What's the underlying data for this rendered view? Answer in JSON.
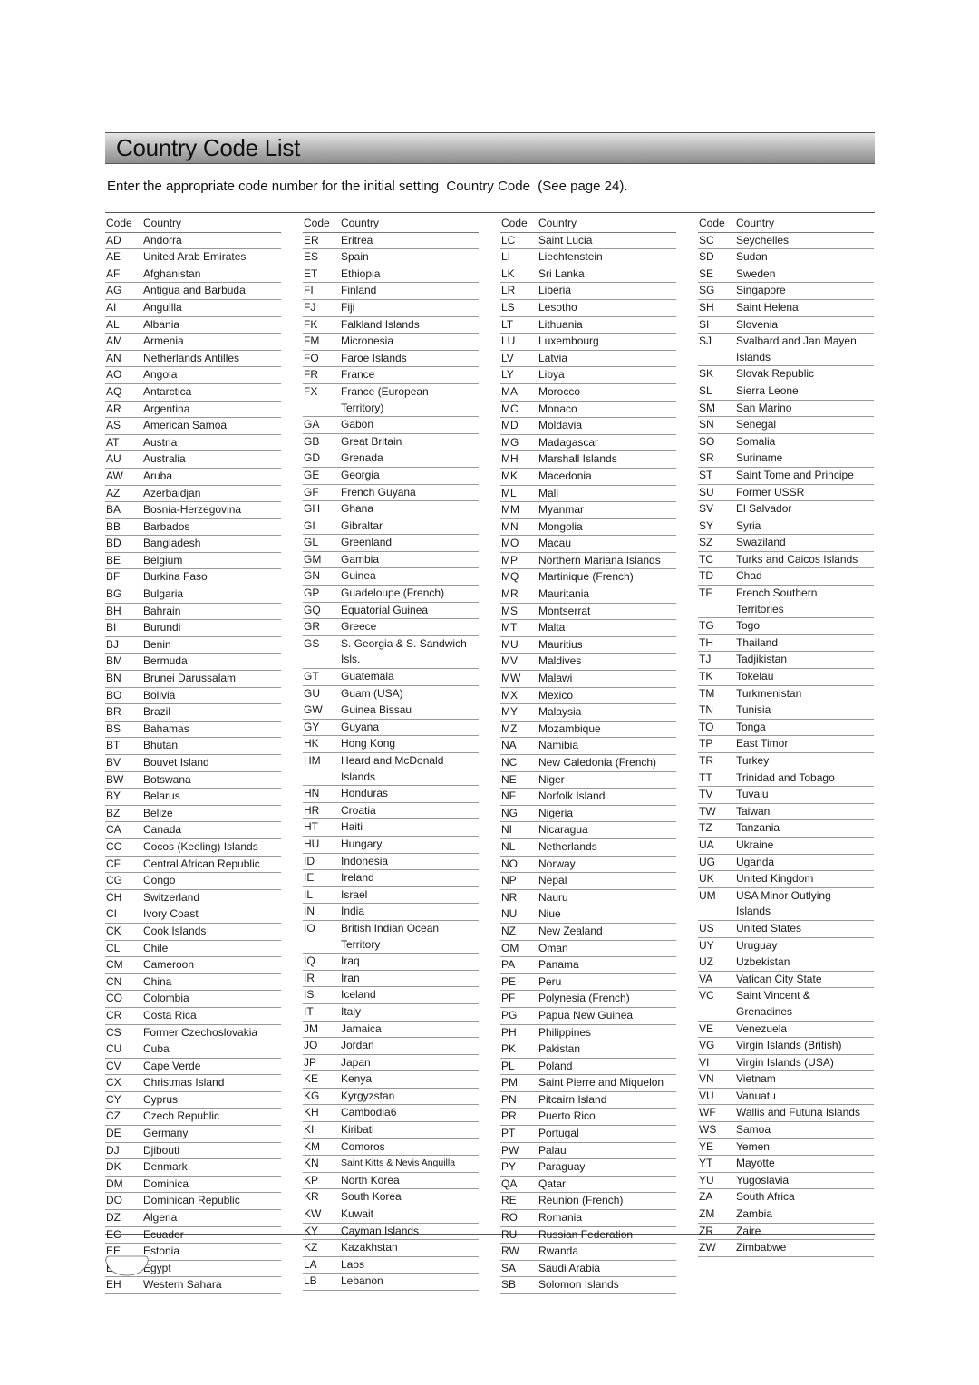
{
  "title": "Country Code List",
  "intro": "Enter the appropriate code number for the initial setting  Country Code  (See page 24).",
  "table": {
    "header": {
      "code": "Code",
      "country": "Country"
    },
    "columns": [
      [
        [
          "AD",
          "Andorra"
        ],
        [
          "AE",
          "United Arab Emirates"
        ],
        [
          "AF",
          "Afghanistan"
        ],
        [
          "AG",
          "Antigua and Barbuda"
        ],
        [
          "AI",
          "Anguilla"
        ],
        [
          "AL",
          "Albania"
        ],
        [
          "AM",
          "Armenia"
        ],
        [
          "AN",
          "Netherlands Antilles"
        ],
        [
          "AO",
          "Angola"
        ],
        [
          "AQ",
          "Antarctica"
        ],
        [
          "AR",
          "Argentina"
        ],
        [
          "AS",
          "American Samoa"
        ],
        [
          "AT",
          "Austria"
        ],
        [
          "AU",
          "Australia"
        ],
        [
          "AW",
          "Aruba"
        ],
        [
          "AZ",
          "Azerbaidjan"
        ],
        [
          "BA",
          "Bosnia-Herzegovina"
        ],
        [
          "BB",
          "Barbados"
        ],
        [
          "BD",
          "Bangladesh"
        ],
        [
          "BE",
          "Belgium"
        ],
        [
          "BF",
          "Burkina Faso"
        ],
        [
          "BG",
          "Bulgaria"
        ],
        [
          "BH",
          "Bahrain"
        ],
        [
          "BI",
          "Burundi"
        ],
        [
          "BJ",
          "Benin"
        ],
        [
          "BM",
          "Bermuda"
        ],
        [
          "BN",
          "Brunei Darussalam"
        ],
        [
          "BO",
          "Bolivia"
        ],
        [
          "BR",
          "Brazil"
        ],
        [
          "BS",
          "Bahamas"
        ],
        [
          "BT",
          "Bhutan"
        ],
        [
          "BV",
          "Bouvet Island"
        ],
        [
          "BW",
          "Botswana"
        ],
        [
          "BY",
          "Belarus"
        ],
        [
          "BZ",
          "Belize"
        ],
        [
          "CA",
          "Canada"
        ],
        [
          "CC",
          "Cocos (Keeling) Islands"
        ],
        [
          "CF",
          "Central African Republic"
        ],
        [
          "CG",
          "Congo"
        ],
        [
          "CH",
          "Switzerland"
        ],
        [
          "CI",
          "Ivory Coast"
        ],
        [
          "CK",
          "Cook Islands"
        ],
        [
          "CL",
          "Chile"
        ],
        [
          "CM",
          "Cameroon"
        ],
        [
          "CN",
          "China"
        ],
        [
          "CO",
          "Colombia"
        ],
        [
          "CR",
          "Costa Rica"
        ],
        [
          "CS",
          "Former Czechoslovakia"
        ],
        [
          "CU",
          "Cuba"
        ],
        [
          "CV",
          "Cape Verde"
        ],
        [
          "CX",
          "Christmas Island"
        ],
        [
          "CY",
          "Cyprus"
        ],
        [
          "CZ",
          "Czech Republic"
        ],
        [
          "DE",
          "Germany"
        ],
        [
          "DJ",
          "Djibouti"
        ],
        [
          "DK",
          "Denmark"
        ],
        [
          "DM",
          "Dominica"
        ],
        [
          "DO",
          "Dominican Republic"
        ],
        [
          "DZ",
          "Algeria"
        ],
        [
          "EC",
          "Ecuador"
        ],
        [
          "EE",
          "Estonia"
        ],
        [
          "EG",
          "Egypt"
        ],
        [
          "EH",
          "Western Sahara"
        ]
      ],
      [
        [
          "ER",
          "Eritrea"
        ],
        [
          "ES",
          "Spain"
        ],
        [
          "ET",
          "Ethiopia"
        ],
        [
          "FI",
          "Finland"
        ],
        [
          "FJ",
          "Fiji"
        ],
        [
          "FK",
          "Falkland Islands"
        ],
        [
          "FM",
          "Micronesia"
        ],
        [
          "FO",
          "Faroe Islands"
        ],
        [
          "FR",
          "France"
        ],
        [
          "FX",
          "France (European\nTerritory)"
        ],
        [
          "GA",
          "Gabon"
        ],
        [
          "GB",
          "Great Britain"
        ],
        [
          "GD",
          "Grenada"
        ],
        [
          "GE",
          "Georgia"
        ],
        [
          "GF",
          "French Guyana"
        ],
        [
          "GH",
          "Ghana"
        ],
        [
          "GI",
          "Gibraltar"
        ],
        [
          "GL",
          "Greenland"
        ],
        [
          "GM",
          "Gambia"
        ],
        [
          "GN",
          "Guinea"
        ],
        [
          "GP",
          "Guadeloupe (French)"
        ],
        [
          "GQ",
          "Equatorial Guinea"
        ],
        [
          "GR",
          "Greece"
        ],
        [
          "GS",
          "S. Georgia & S. Sandwich\nIsls."
        ],
        [
          "GT",
          "Guatemala"
        ],
        [
          "GU",
          "Guam (USA)"
        ],
        [
          "GW",
          "Guinea Bissau"
        ],
        [
          "GY",
          "Guyana"
        ],
        [
          "HK",
          "Hong Kong"
        ],
        [
          "HM",
          "Heard and McDonald\nIslands"
        ],
        [
          "HN",
          "Honduras"
        ],
        [
          "HR",
          "Croatia"
        ],
        [
          "HT",
          "Haiti"
        ],
        [
          "HU",
          "Hungary"
        ],
        [
          "ID",
          "Indonesia"
        ],
        [
          "IE",
          "Ireland"
        ],
        [
          "IL",
          "Israel"
        ],
        [
          "IN",
          "India"
        ],
        [
          "IO",
          "British Indian Ocean\nTerritory"
        ],
        [
          "IQ",
          "Iraq"
        ],
        [
          "IR",
          "Iran"
        ],
        [
          "IS",
          "Iceland"
        ],
        [
          "IT",
          "Italy"
        ],
        [
          "JM",
          "Jamaica"
        ],
        [
          "JO",
          "Jordan"
        ],
        [
          "JP",
          "Japan"
        ],
        [
          "KE",
          "Kenya"
        ],
        [
          "KG",
          "Kyrgyzstan"
        ],
        [
          "KH",
          "Cambodia6"
        ],
        [
          "KI",
          "Kiribati"
        ],
        [
          "KM",
          "Comoros"
        ],
        [
          "KN",
          "Saint Kitts & Nevis Anguilla"
        ],
        [
          "KP",
          "North Korea"
        ],
        [
          "KR",
          "South Korea"
        ],
        [
          "KW",
          "Kuwait"
        ],
        [
          "KY",
          "Cayman Islands"
        ],
        [
          "KZ",
          "Kazakhstan"
        ],
        [
          "LA",
          "Laos"
        ],
        [
          "LB",
          "Lebanon"
        ]
      ],
      [
        [
          "LC",
          "Saint Lucia"
        ],
        [
          "LI",
          "Liechtenstein"
        ],
        [
          "LK",
          "Sri Lanka"
        ],
        [
          "LR",
          "Liberia"
        ],
        [
          "LS",
          "Lesotho"
        ],
        [
          "LT",
          "Lithuania"
        ],
        [
          "LU",
          "Luxembourg"
        ],
        [
          "LV",
          "Latvia"
        ],
        [
          "LY",
          "Libya"
        ],
        [
          "MA",
          "Morocco"
        ],
        [
          "MC",
          "Monaco"
        ],
        [
          "MD",
          "Moldavia"
        ],
        [
          "MG",
          "Madagascar"
        ],
        [
          "MH",
          "Marshall Islands"
        ],
        [
          "MK",
          "Macedonia"
        ],
        [
          "ML",
          "Mali"
        ],
        [
          "MM",
          "Myanmar"
        ],
        [
          "MN",
          "Mongolia"
        ],
        [
          "MO",
          "Macau"
        ],
        [
          "MP",
          "Northern Mariana Islands"
        ],
        [
          "MQ",
          "Martinique (French)"
        ],
        [
          "MR",
          "Mauritania"
        ],
        [
          "MS",
          "Montserrat"
        ],
        [
          "MT",
          "Malta"
        ],
        [
          "MU",
          "Mauritius"
        ],
        [
          "MV",
          "Maldives"
        ],
        [
          "MW",
          "Malawi"
        ],
        [
          "MX",
          "Mexico"
        ],
        [
          "MY",
          "Malaysia"
        ],
        [
          "MZ",
          "Mozambique"
        ],
        [
          "NA",
          "Namibia"
        ],
        [
          "NC",
          "New Caledonia (French)"
        ],
        [
          "NE",
          "Niger"
        ],
        [
          "NF",
          "Norfolk Island"
        ],
        [
          "NG",
          "Nigeria"
        ],
        [
          "NI",
          "Nicaragua"
        ],
        [
          "NL",
          "Netherlands"
        ],
        [
          "NO",
          "Norway"
        ],
        [
          "NP",
          "Nepal"
        ],
        [
          "NR",
          "Nauru"
        ],
        [
          "NU",
          "Niue"
        ],
        [
          "NZ",
          "New Zealand"
        ],
        [
          "OM",
          "Oman"
        ],
        [
          "PA",
          "Panama"
        ],
        [
          "PE",
          "Peru"
        ],
        [
          "PF",
          "Polynesia (French)"
        ],
        [
          "PG",
          "Papua New Guinea"
        ],
        [
          "PH",
          "Philippines"
        ],
        [
          "PK",
          "Pakistan"
        ],
        [
          "PL",
          "Poland"
        ],
        [
          "PM",
          "Saint Pierre and Miquelon"
        ],
        [
          "PN",
          "Pitcairn Island"
        ],
        [
          "PR",
          "Puerto Rico"
        ],
        [
          "PT",
          "Portugal"
        ],
        [
          "PW",
          "Palau"
        ],
        [
          "PY",
          "Paraguay"
        ],
        [
          "QA",
          "Qatar"
        ],
        [
          "RE",
          "Reunion (French)"
        ],
        [
          "RO",
          "Romania"
        ],
        [
          "RU",
          "Russian Federation"
        ],
        [
          "RW",
          "Rwanda"
        ],
        [
          "SA",
          "Saudi Arabia"
        ],
        [
          "SB",
          "Solomon Islands"
        ]
      ],
      [
        [
          "SC",
          "Seychelles"
        ],
        [
          "SD",
          "Sudan"
        ],
        [
          "SE",
          "Sweden"
        ],
        [
          "SG",
          "Singapore"
        ],
        [
          "SH",
          "Saint Helena"
        ],
        [
          "SI",
          "Slovenia"
        ],
        [
          "SJ",
          "Svalbard and Jan Mayen\nIslands"
        ],
        [
          "SK",
          "Slovak Republic"
        ],
        [
          "SL",
          "Sierra Leone"
        ],
        [
          "SM",
          "San Marino"
        ],
        [
          "SN",
          "Senegal"
        ],
        [
          "SO",
          "Somalia"
        ],
        [
          "SR",
          "Suriname"
        ],
        [
          "ST",
          "Saint Tome and Principe"
        ],
        [
          "SU",
          "Former USSR"
        ],
        [
          "SV",
          "El Salvador"
        ],
        [
          "SY",
          "Syria"
        ],
        [
          "SZ",
          "Swaziland"
        ],
        [
          "TC",
          "Turks and Caicos Islands"
        ],
        [
          "TD",
          "Chad"
        ],
        [
          "TF",
          "French Southern\nTerritories"
        ],
        [
          "TG",
          "Togo"
        ],
        [
          "TH",
          "Thailand"
        ],
        [
          "TJ",
          "Tadjikistan"
        ],
        [
          "TK",
          "Tokelau"
        ],
        [
          "TM",
          "Turkmenistan"
        ],
        [
          "TN",
          "Tunisia"
        ],
        [
          "TO",
          "Tonga"
        ],
        [
          "TP",
          "East Timor"
        ],
        [
          "TR",
          "Turkey"
        ],
        [
          "TT",
          "Trinidad and Tobago"
        ],
        [
          "TV",
          "Tuvalu"
        ],
        [
          "TW",
          "Taiwan"
        ],
        [
          "TZ",
          "Tanzania"
        ],
        [
          "UA",
          "Ukraine"
        ],
        [
          "UG",
          "Uganda"
        ],
        [
          "UK",
          "United Kingdom"
        ],
        [
          "UM",
          "USA Minor Outlying\nIslands"
        ],
        [
          "US",
          "United States"
        ],
        [
          "UY",
          "Uruguay"
        ],
        [
          "UZ",
          "Uzbekistan"
        ],
        [
          "VA",
          "Vatican City State"
        ],
        [
          "VC",
          "Saint Vincent &\nGrenadines"
        ],
        [
          "VE",
          "Venezuela"
        ],
        [
          "VG",
          "Virgin Islands (British)"
        ],
        [
          "VI",
          "Virgin Islands (USA)"
        ],
        [
          "VN",
          "Vietnam"
        ],
        [
          "VU",
          "Vanuatu"
        ],
        [
          "WF",
          "Wallis and Futuna Islands"
        ],
        [
          "WS",
          "Samoa"
        ],
        [
          "YE",
          "Yemen"
        ],
        [
          "YT",
          "Mayotte"
        ],
        [
          "YU",
          "Yugoslavia"
        ],
        [
          "ZA",
          "South Africa"
        ],
        [
          "ZM",
          "Zambia"
        ],
        [
          "ZR",
          "Zaire"
        ],
        [
          "ZW",
          "Zimbabwe"
        ]
      ]
    ],
    "small_text_codes": [
      "KN"
    ]
  }
}
